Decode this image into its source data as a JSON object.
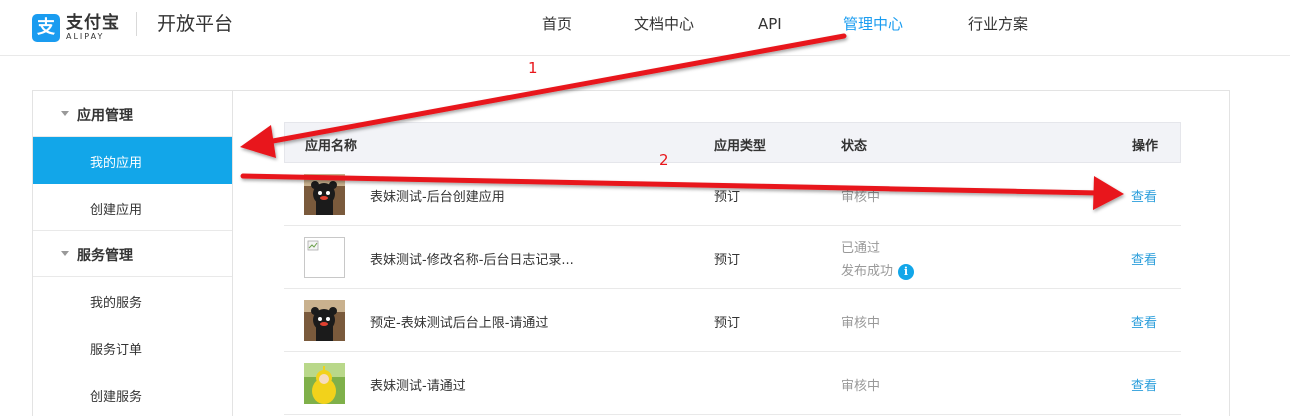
{
  "header": {
    "logo_cn": "支付宝",
    "logo_en": "ALIPAY",
    "platform_title": "开放平台",
    "nav": [
      {
        "label": "首页",
        "active": false
      },
      {
        "label": "文档中心",
        "active": false
      },
      {
        "label": "API",
        "active": false
      },
      {
        "label": "管理中心",
        "active": true
      },
      {
        "label": "行业方案",
        "active": false
      }
    ]
  },
  "sidebar": {
    "groups": [
      {
        "title": "应用管理",
        "items": [
          {
            "label": "我的应用",
            "active": true
          },
          {
            "label": "创建应用",
            "active": false
          }
        ]
      },
      {
        "title": "服务管理",
        "items": [
          {
            "label": "我的服务",
            "active": false
          },
          {
            "label": "服务订单",
            "active": false
          },
          {
            "label": "创建服务",
            "active": false
          }
        ]
      }
    ]
  },
  "table": {
    "headers": {
      "name": "应用名称",
      "type": "应用类型",
      "status": "状态",
      "action": "操作"
    },
    "rows": [
      {
        "name": "表妹测试-后台创建应用",
        "type": "预订",
        "status": "审核中",
        "status2": "",
        "action": "查看",
        "thumb": "bear"
      },
      {
        "name": "表妹测试-修改名称-后台日志记录...",
        "type": "预订",
        "status": "已通过",
        "status2": "发布成功",
        "action": "查看",
        "thumb": "broken"
      },
      {
        "name": "预定-表妹测试后台上限-请通过",
        "type": "预订",
        "status": "审核中",
        "status2": "",
        "action": "查看",
        "thumb": "bear"
      },
      {
        "name": "表妹测试-请通过",
        "type": "",
        "status": "审核中",
        "status2": "",
        "action": "查看",
        "thumb": "yellow"
      }
    ]
  },
  "annotations": {
    "label_1": "1",
    "label_2": "2",
    "arrow_color": "#e8161b"
  },
  "colors": {
    "accent": "#1a9cf0",
    "active_sidebar": "#12a6e9",
    "link": "#2b9edb"
  }
}
